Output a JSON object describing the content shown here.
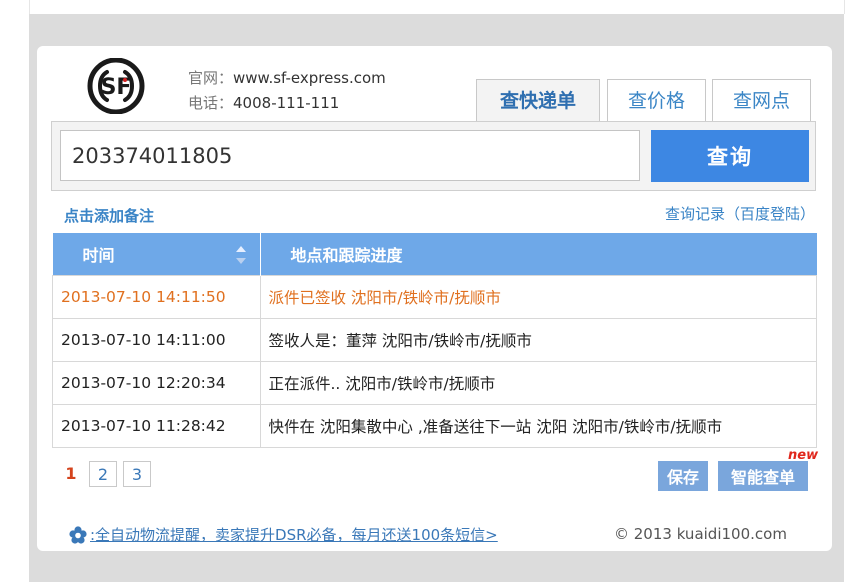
{
  "company": {
    "name": "SF",
    "website_label": "官网：",
    "website": "www.sf-express.com",
    "phone_label": "电话：",
    "phone": "4008-111-111",
    "logo_color": "#1a1a1a",
    "logo_accent": "#d42020"
  },
  "tabs": [
    {
      "label": "查快递单",
      "active": true
    },
    {
      "label": "查价格",
      "active": false
    },
    {
      "label": "查网点",
      "active": false
    }
  ],
  "search": {
    "value": "203374011805",
    "button_label": "查询"
  },
  "add_note_label": "点击添加备注",
  "history_link": "查询记录（百度登陆）",
  "table": {
    "headers": {
      "time": "时间",
      "location": "地点和跟踪进度"
    },
    "rows": [
      {
        "time": "2013-07-10 14:11:50",
        "status": "派件已签收 沈阳市/铁岭市/抚顺市",
        "highlight": true
      },
      {
        "time": "2013-07-10 14:11:00",
        "status": "签收人是：董萍 沈阳市/铁岭市/抚顺市",
        "highlight": false
      },
      {
        "time": "2013-07-10 12:20:34",
        "status": "正在派件.. 沈阳市/铁岭市/抚顺市",
        "highlight": false
      },
      {
        "time": "2013-07-10 11:28:42",
        "status": "快件在 沈阳集散中心 ,准备送往下一站 沈阳 沈阳市/铁岭市/抚顺市",
        "highlight": false
      }
    ]
  },
  "pagination": {
    "pages": [
      "1",
      "2",
      "3"
    ],
    "current": "1"
  },
  "buttons": {
    "save": "保存",
    "smart": "智能查单",
    "new_badge": "new"
  },
  "promo": {
    "icon": "flower-icon",
    "text": ":全自动物流提醒，卖家提升DSR必备，每月还送100条短信>"
  },
  "copyright": "© 2013 kuaidi100.com",
  "colors": {
    "accent": "#3d87e3",
    "header": "#6ea8e8",
    "highlight": "#e0701f",
    "new": "#e0271c"
  }
}
